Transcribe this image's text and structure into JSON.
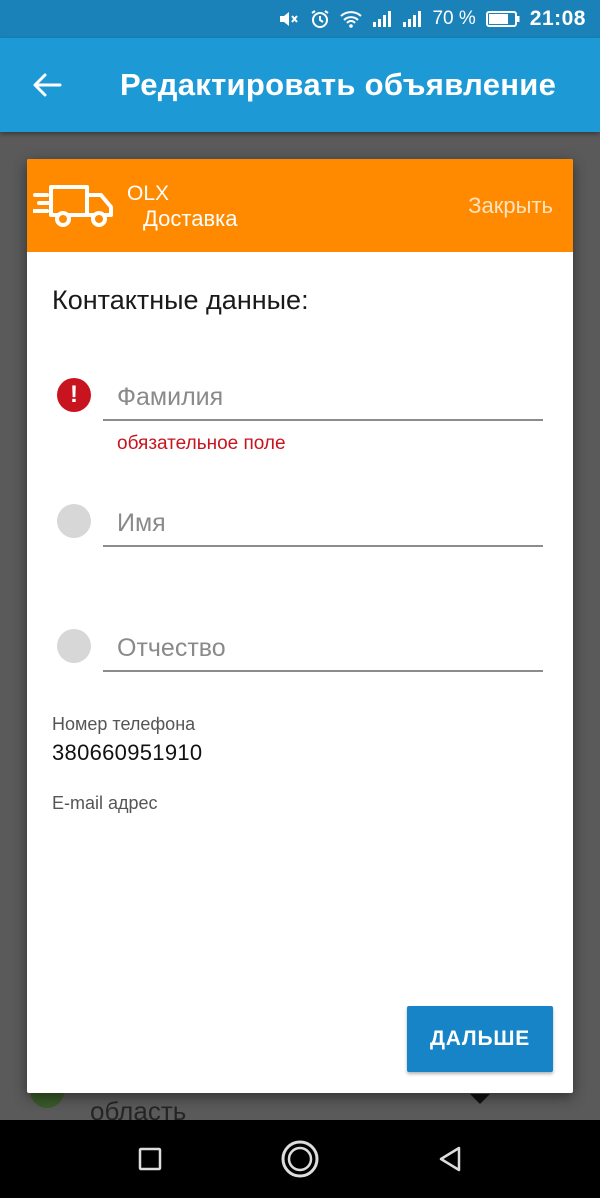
{
  "status_bar": {
    "battery_percent": "70 %",
    "time": "21:08",
    "icons": [
      "mute-icon",
      "alarm-icon",
      "wifi-icon",
      "signal-icon",
      "signal-icon-2",
      "battery-icon"
    ]
  },
  "app_bar": {
    "title": "Редактировать объявление",
    "back_icon": "arrow-left-icon"
  },
  "dialog": {
    "brand": "OLX",
    "service": "Доставка",
    "close_label": "Закрыть",
    "section_title": "Контактные данные:",
    "fields": {
      "last_name": {
        "placeholder": "Фамилия",
        "value": "",
        "error": "обязательное поле"
      },
      "first_name": {
        "placeholder": "Имя",
        "value": ""
      },
      "patronymic": {
        "placeholder": "Отчество",
        "value": ""
      }
    },
    "phone_label": "Номер телефона",
    "phone_value": "380660951910",
    "email_label": "E-mail адрес",
    "next_label": "ДАЛЬШЕ"
  },
  "background": {
    "peek_text": "область"
  },
  "colors": {
    "status_bar": "#1a82b8",
    "app_bar": "#1d9ad6",
    "dialog_header": "#ff8a00",
    "error": "#c8141e",
    "primary_button": "#1784c7"
  }
}
